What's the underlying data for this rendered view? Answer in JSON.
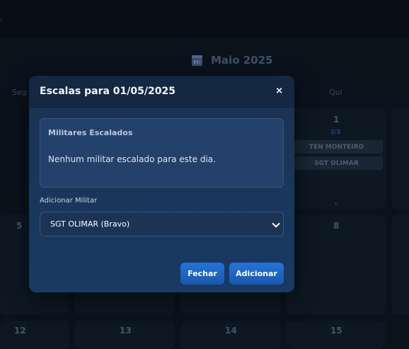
{
  "calendar": {
    "month_label": "Maio 2025",
    "weekdays": {
      "seg": "Seg",
      "qui": "Qui"
    },
    "days": {
      "d1": "1",
      "d5": "5",
      "d8": "8",
      "d12": "12",
      "d13": "13",
      "d14": "14",
      "d15": "15"
    },
    "day1": {
      "count": "2/3",
      "assignments": [
        "TEN MONTEIRO",
        "SGT OLIMAR"
      ]
    }
  },
  "modal": {
    "title": "Escalas para 01/05/2025",
    "close_label": "×",
    "assigned_title": "Militares Escalados",
    "empty_message": "Nenhum militar escalado para este dia.",
    "add_label": "Adicionar Militar",
    "select_value": "SGT OLIMAR (Bravo)",
    "close_button": "Fechar",
    "add_button": "Adicionar"
  },
  "colors": {
    "accent": "#2474d6",
    "modal_bg": "#1a3152",
    "page_bg": "#0a121c"
  }
}
